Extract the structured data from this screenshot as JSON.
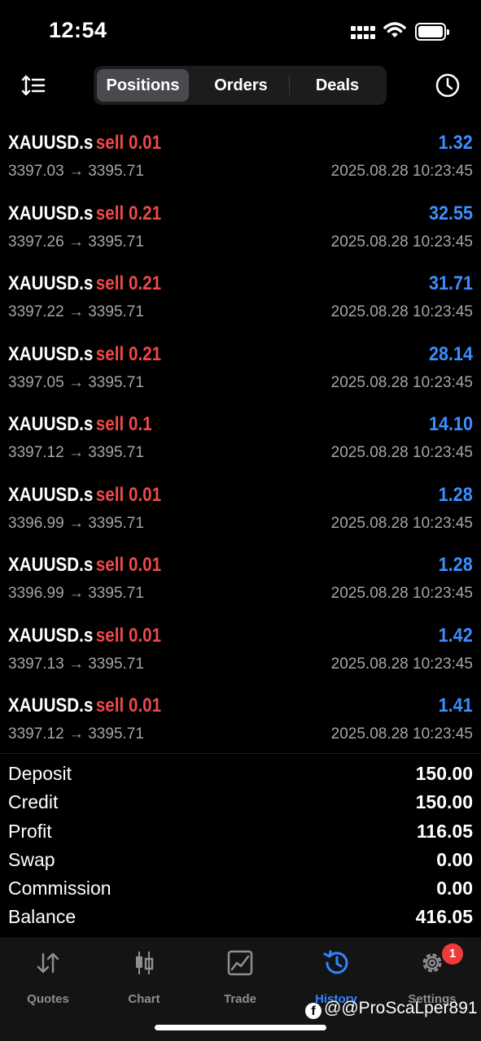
{
  "status_bar": {
    "time": "12:54"
  },
  "header": {
    "tabs": [
      {
        "label": "Positions",
        "active": true
      },
      {
        "label": "Orders",
        "active": false
      },
      {
        "label": "Deals",
        "active": false
      }
    ]
  },
  "positions": [
    {
      "symbol": "XAUUSD.s",
      "side": "sell 0.01",
      "profit": "1.32",
      "prices": "3397.03 → 3395.71",
      "time": "2025.08.28 10:23:45"
    },
    {
      "symbol": "XAUUSD.s",
      "side": "sell 0.21",
      "profit": "32.55",
      "prices": "3397.26 → 3395.71",
      "time": "2025.08.28 10:23:45"
    },
    {
      "symbol": "XAUUSD.s",
      "side": "sell 0.21",
      "profit": "31.71",
      "prices": "3397.22 → 3395.71",
      "time": "2025.08.28 10:23:45"
    },
    {
      "symbol": "XAUUSD.s",
      "side": "sell 0.21",
      "profit": "28.14",
      "prices": "3397.05 → 3395.71",
      "time": "2025.08.28 10:23:45"
    },
    {
      "symbol": "XAUUSD.s",
      "side": "sell 0.1",
      "profit": "14.10",
      "prices": "3397.12 → 3395.71",
      "time": "2025.08.28 10:23:45"
    },
    {
      "symbol": "XAUUSD.s",
      "side": "sell 0.01",
      "profit": "1.28",
      "prices": "3396.99 → 3395.71",
      "time": "2025.08.28 10:23:45"
    },
    {
      "symbol": "XAUUSD.s",
      "side": "sell 0.01",
      "profit": "1.28",
      "prices": "3396.99 → 3395.71",
      "time": "2025.08.28 10:23:45"
    },
    {
      "symbol": "XAUUSD.s",
      "side": "sell 0.01",
      "profit": "1.42",
      "prices": "3397.13 → 3395.71",
      "time": "2025.08.28 10:23:45"
    },
    {
      "symbol": "XAUUSD.s",
      "side": "sell 0.01",
      "profit": "1.41",
      "prices": "3397.12 → 3395.71",
      "time": "2025.08.28 10:23:45"
    }
  ],
  "summary": [
    {
      "label": "Deposit",
      "value": "150.00"
    },
    {
      "label": "Credit",
      "value": "150.00"
    },
    {
      "label": "Profit",
      "value": "116.05"
    },
    {
      "label": "Swap",
      "value": "0.00"
    },
    {
      "label": "Commission",
      "value": "0.00"
    },
    {
      "label": "Balance",
      "value": "416.05"
    }
  ],
  "tabbar": {
    "items": [
      {
        "label": "Quotes",
        "icon": "quotes-arrows-icon"
      },
      {
        "label": "Chart",
        "icon": "candlestick-icon"
      },
      {
        "label": "Trade",
        "icon": "trade-chart-icon"
      },
      {
        "label": "History",
        "icon": "history-clock-icon",
        "active": true
      },
      {
        "label": "Settings",
        "icon": "gear-icon",
        "badge": "1"
      }
    ]
  },
  "watermark": "@@ProScaLper891",
  "colors": {
    "sell": "#f04848",
    "profit": "#3a8fff",
    "active_tab": "#2f86ff",
    "badge": "#ef3b3b"
  }
}
